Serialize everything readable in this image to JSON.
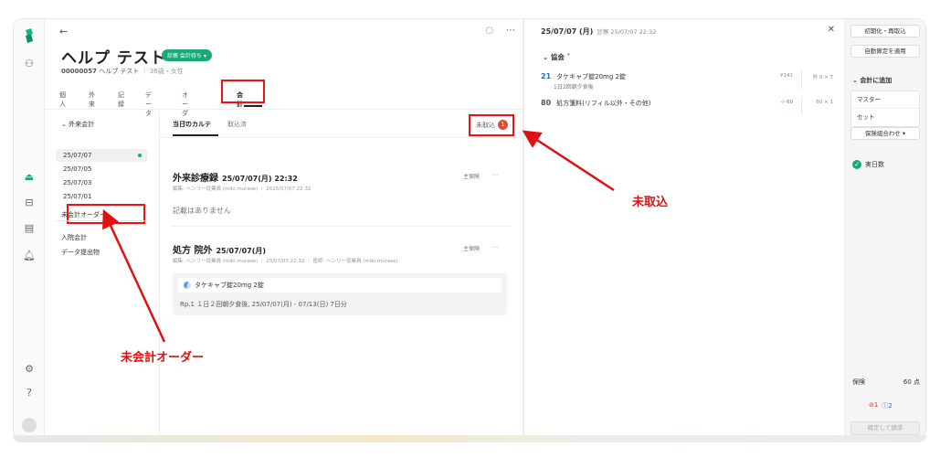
{
  "patient": {
    "name": "ヘルプ テスト",
    "badge": "診察 会計待ち ▾",
    "id": "00000057",
    "kana": "ヘルプ テスト",
    "age_sex": "36歳・女性"
  },
  "tabs": [
    {
      "label": "個人"
    },
    {
      "label": "外来"
    },
    {
      "label": "記録"
    },
    {
      "label": "データ"
    },
    {
      "label": "オーダー"
    },
    {
      "label": "会計"
    }
  ],
  "subnav": {
    "group": "外来会計",
    "dates": [
      "25/07/07",
      "25/07/05",
      "25/07/03",
      "25/07/01"
    ],
    "unbilled_orders": "未会計オーダー",
    "inpatient": "入院会計",
    "data_submission": "データ提出物"
  },
  "content": {
    "tab_today": "当日のカルテ",
    "tab_imported": "取込済",
    "unfetched_label": "未取込",
    "unfetched_count": "1",
    "record1": {
      "title": "外来診療録",
      "datetime": "25/07/07(月) 22:32",
      "meta": "編集: ヘンリー従業員 (miki.murase) ・ 2025/07/07 22:32",
      "insurance": "主保険",
      "empty": "記載はありません"
    },
    "record2": {
      "title": "処方 院外",
      "datetime": "25/07/07(月)",
      "meta": "編集: ヘンリー従業員 (miki.murase) ・ 25/07/07 22:32 ｜ 医師: ヘンリー従業員 (miki.murase)",
      "insurance": "主保険",
      "drug": "タケキャブ錠20mg  2錠",
      "rp": "Rp.1   １日２回朝夕食後,  25/07/07(月) - 07/13(日) 7日分"
    }
  },
  "billing": {
    "date": "25/07/07 (月)",
    "date_sub": "診察 25/07/07 22:32",
    "group": "協会",
    "rows": [
      {
        "qty": "21",
        "name": "タケキャブ錠20mg  2錠",
        "sub": "1日2回朝夕食後",
        "code": "¥141",
        "mult": "外 0 × 7"
      },
      {
        "qty": "80",
        "name": "処方箋料(リフィル以外・その他)",
        "sub": "",
        "code": "60",
        "mult": "60 × 1"
      }
    ]
  },
  "actions": {
    "initialize": "初期化・再取込",
    "auto_calc": "自動算定を適用",
    "add_head": "会計に追加",
    "master": "マスター",
    "set": "セット",
    "insurance_combo": "保険組合わせ ▾",
    "status": "実日数",
    "insurance_label": "保険",
    "points": "60 点",
    "error_count": "1",
    "info_count": "2",
    "confirm": "確定して請求"
  },
  "annotations": {
    "unbilled": "未会計オーダー",
    "unfetched": "未取込"
  },
  "colors": {
    "accent": "#1aa97a",
    "annotation": "#e01010",
    "link": "#1a6fc4"
  }
}
